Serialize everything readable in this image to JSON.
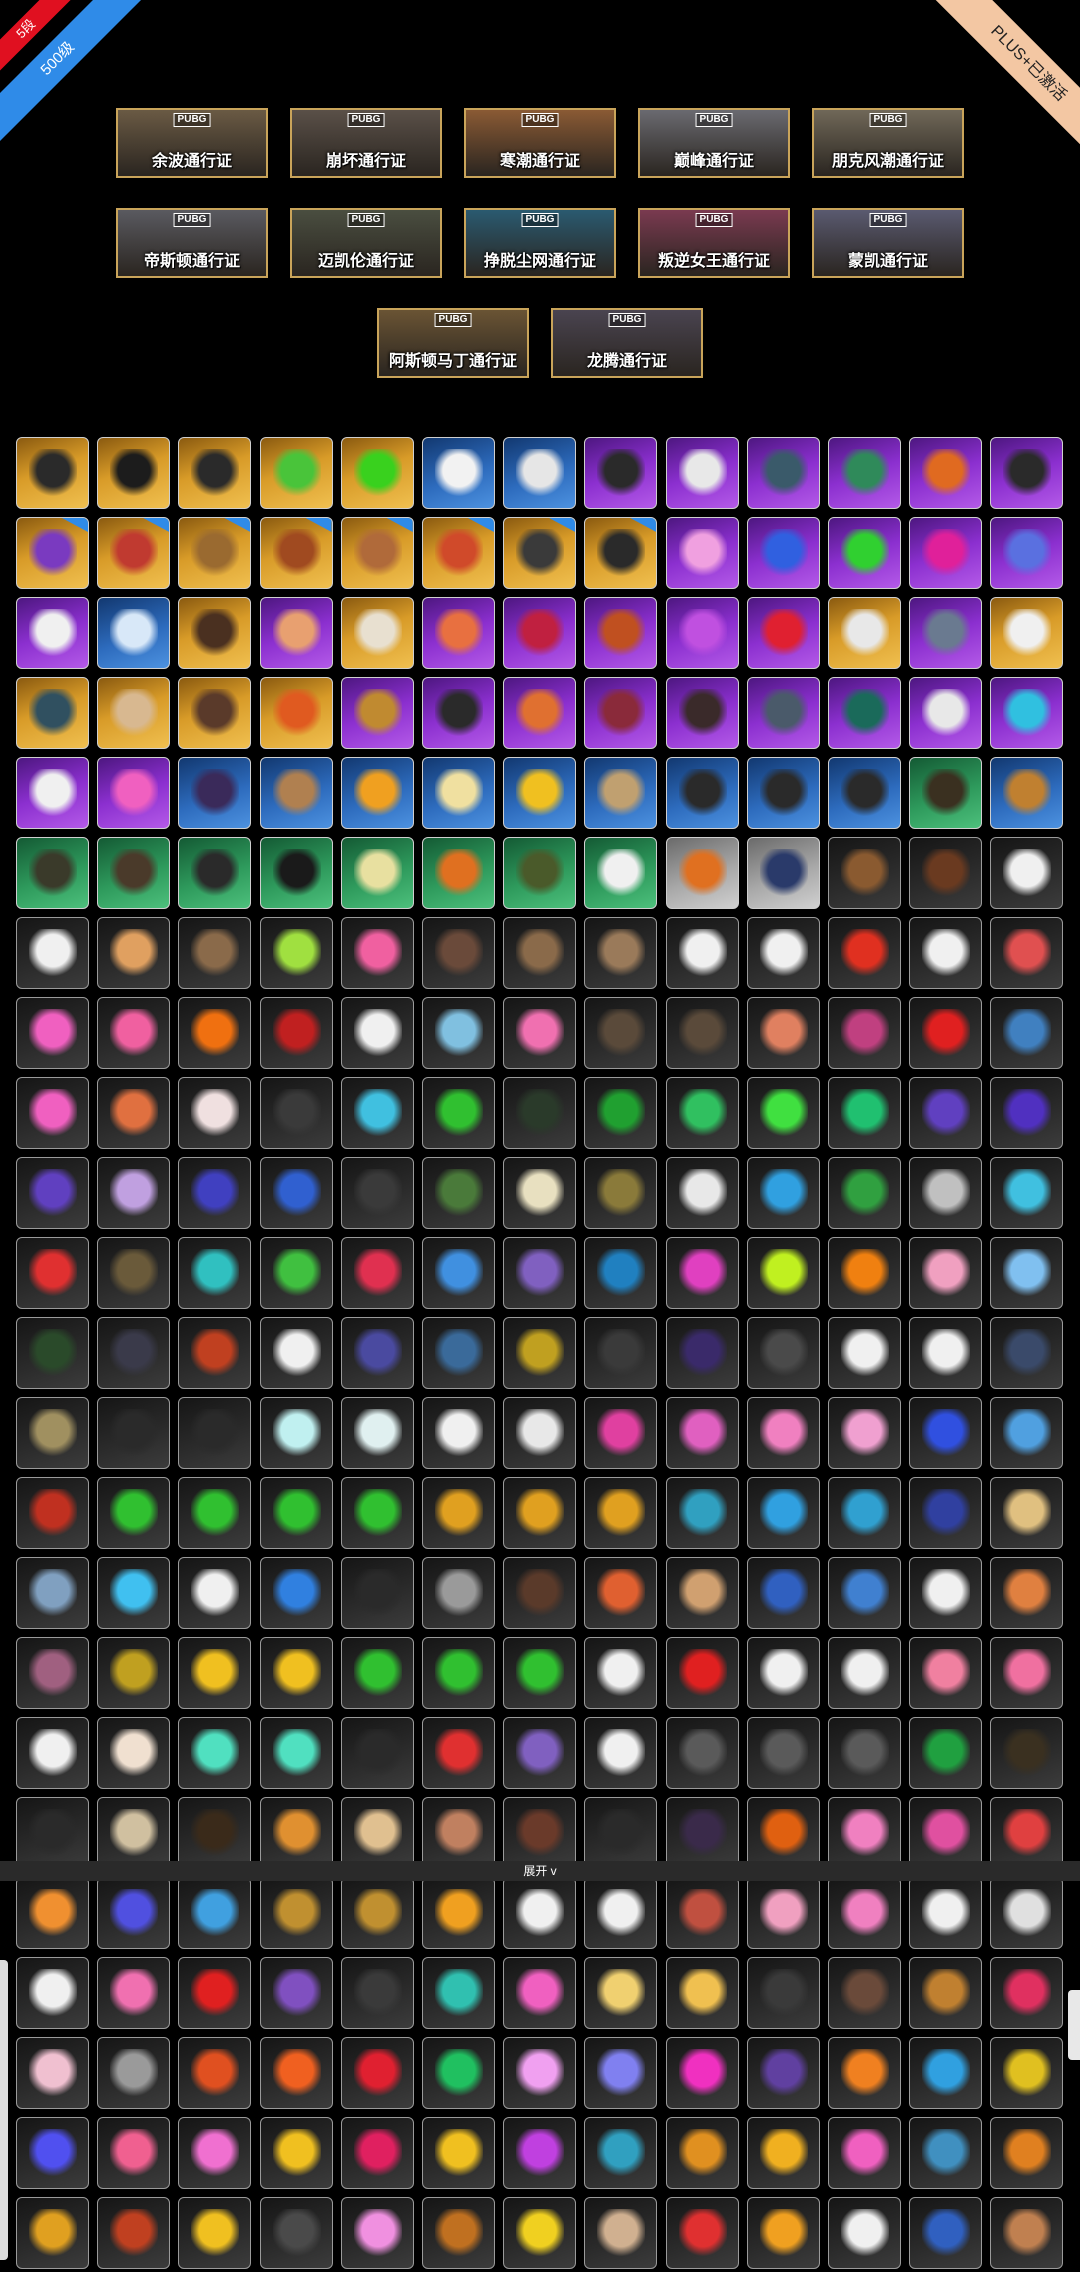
{
  "badges": {
    "rank": "5段",
    "level": "500级",
    "plus": "PLUS+已激活"
  },
  "passes": {
    "row1": [
      {
        "name": "余波通行证",
        "logo": "PUBG",
        "tone": "#6a5a44"
      },
      {
        "name": "崩坏通行证",
        "logo": "PUBG",
        "tone": "#5a5048"
      },
      {
        "name": "寒潮通行证",
        "logo": "PUBG",
        "tone": "#8a5a34"
      },
      {
        "name": "巅峰通行证",
        "logo": "PUBG",
        "tone": "#6a6a70"
      },
      {
        "name": "朋克风潮通行证",
        "logo": "PUBG",
        "tone": "#706858"
      }
    ],
    "row2": [
      {
        "name": "帝斯顿通行证",
        "logo": "PUBG",
        "tone": "#5a5a60"
      },
      {
        "name": "迈凯伦通行证",
        "logo": "PUBG",
        "tone": "#4a4e40"
      },
      {
        "name": "挣脱尘网通行证",
        "logo": "PUBG",
        "tone": "#2a5a70"
      },
      {
        "name": "叛逆女王通行证",
        "logo": "PUBG",
        "tone": "#7a3a50"
      },
      {
        "name": "蒙凯通行证",
        "logo": "PUBG",
        "tone": "#5a5a70"
      }
    ],
    "row3": [
      {
        "name": "阿斯顿马丁通行证",
        "logo": "PUBG",
        "tone": "#6a5434"
      },
      {
        "name": "龙腾通行证",
        "logo": "PUBG",
        "tone": "#4a4450"
      }
    ]
  },
  "expand_label": "展开 v",
  "items": {
    "rows": [
      [
        [
          "gold",
          "#2a2a2a"
        ],
        [
          "gold",
          "#1c1c1c"
        ],
        [
          "gold",
          "#2a2a2a"
        ],
        [
          "gold",
          "#49c43a"
        ],
        [
          "gold",
          "#39d11e"
        ],
        [
          "blue",
          "#f2f2f2"
        ],
        [
          "blue",
          "#e6e6e6"
        ],
        [
          "purple",
          "#2a2a2a"
        ],
        [
          "purple",
          "#e8e8e8"
        ],
        [
          "purple",
          "#3a5a6a"
        ],
        [
          "purple",
          "#2f8a5a"
        ],
        [
          "purple",
          "#e06a20"
        ],
        [
          "purple",
          "#2a2a2a"
        ]
      ],
      [
        [
          "gold",
          "#7a3ac0",
          1
        ],
        [
          "gold",
          "#c03a30",
          1
        ],
        [
          "gold",
          "#9a6a30",
          1
        ],
        [
          "gold",
          "#a04a20",
          1
        ],
        [
          "gold",
          "#b06a3a",
          1
        ],
        [
          "gold",
          "#d04a2a",
          1
        ],
        [
          "gold",
          "#3a3a3a",
          1
        ],
        [
          "gold",
          "#2a2a2a",
          1
        ],
        [
          "purple",
          "#f0a0e0"
        ],
        [
          "purple",
          "#3060e0"
        ],
        [
          "purple",
          "#30d030"
        ],
        [
          "purple",
          "#e0209a"
        ],
        [
          "purple",
          "#5a70e0"
        ]
      ],
      [
        [
          "purple",
          "#f0f0f0"
        ],
        [
          "blue",
          "#d8e8f8"
        ],
        [
          "gold",
          "#4a3020"
        ],
        [
          "purple",
          "#e8a070"
        ],
        [
          "gold",
          "#e8e0d0"
        ],
        [
          "purple",
          "#e87040"
        ],
        [
          "purple",
          "#c02040"
        ],
        [
          "purple",
          "#c05020"
        ],
        [
          "purple",
          "#c050e0"
        ],
        [
          "purple",
          "#e02030"
        ],
        [
          "gold",
          "#e8e8e8"
        ],
        [
          "purple",
          "#6a7a90"
        ],
        [
          "gold",
          "#f0f0f0"
        ]
      ],
      [
        [
          "gold",
          "#305060"
        ],
        [
          "gold",
          "#d8b890"
        ],
        [
          "gold",
          "#5a3a2a"
        ],
        [
          "gold",
          "#e05a20"
        ],
        [
          "purple",
          "#c08a30"
        ],
        [
          "purple",
          "#2a2a2a"
        ],
        [
          "purple",
          "#e07030"
        ],
        [
          "purple",
          "#8a2a3a"
        ],
        [
          "purple",
          "#3a2a2a"
        ],
        [
          "purple",
          "#4a5a6a"
        ],
        [
          "purple",
          "#1a6a5a"
        ],
        [
          "purple",
          "#e8e8e8"
        ],
        [
          "purple",
          "#30c0e0"
        ]
      ],
      [
        [
          "purple",
          "#f0f0f0"
        ],
        [
          "purple",
          "#f060c0"
        ],
        [
          "blue",
          "#3a2a5a"
        ],
        [
          "blue",
          "#b08050"
        ],
        [
          "blue",
          "#f0a020"
        ],
        [
          "blue",
          "#f0e0a0"
        ],
        [
          "blue",
          "#f0c020"
        ],
        [
          "blue",
          "#c0a070"
        ],
        [
          "blue",
          "#2a2a2a"
        ],
        [
          "blue",
          "#2a2a2a"
        ],
        [
          "blue",
          "#2a2a2a"
        ],
        [
          "green",
          "#3a3020"
        ],
        [
          "blue",
          "#c08030"
        ]
      ],
      [
        [
          "green",
          "#3a3a2a"
        ],
        [
          "green",
          "#4a3a2a"
        ],
        [
          "green",
          "#2a2a2a"
        ],
        [
          "green",
          "#1a1a1a"
        ],
        [
          "green",
          "#e8e0a0"
        ],
        [
          "green",
          "#e07020"
        ],
        [
          "green",
          "#4a5a2a"
        ],
        [
          "green",
          "#f0f0f0"
        ],
        [
          "gray",
          "#e07020"
        ],
        [
          "gray",
          "#2a3a6a"
        ],
        [
          "dark",
          "#8a5a30"
        ],
        [
          "dark",
          "#6a3a20"
        ],
        [
          "dark",
          "#f0f0f0"
        ]
      ],
      [
        [
          "dark",
          "#f0f0f0"
        ],
        [
          "dark",
          "#e0a060"
        ],
        [
          "dark",
          "#8a6a4a"
        ],
        [
          "dark",
          "#a0e040"
        ],
        [
          "dark",
          "#f060a0"
        ],
        [
          "dark",
          "#6a4a3a"
        ],
        [
          "dark",
          "#8a6a4a"
        ],
        [
          "dark",
          "#9a7a5a"
        ],
        [
          "dark",
          "#f0f0f0"
        ],
        [
          "dark",
          "#f0f0f0"
        ],
        [
          "dark",
          "#e03020"
        ],
        [
          "dark",
          "#f0f0f0"
        ],
        [
          "dark",
          "#e05050"
        ]
      ],
      [
        [
          "dark",
          "#f060c0"
        ],
        [
          "dark",
          "#f060a0"
        ],
        [
          "dark",
          "#f07010"
        ],
        [
          "dark",
          "#c02020"
        ],
        [
          "dark",
          "#f0f0f0"
        ],
        [
          "dark",
          "#80c0e0"
        ],
        [
          "dark",
          "#f070b0"
        ],
        [
          "dark",
          "#5a4a3a"
        ],
        [
          "dark",
          "#5a4a3a"
        ],
        [
          "dark",
          "#e08060"
        ],
        [
          "dark",
          "#c04080"
        ],
        [
          "dark",
          "#e02020"
        ],
        [
          "dark",
          "#4080c0"
        ]
      ],
      [
        [
          "dark",
          "#f060c0"
        ],
        [
          "dark",
          "#e07040"
        ],
        [
          "dark",
          "#f0e0e0"
        ],
        [
          "dark",
          "#3a3a3a"
        ],
        [
          "dark",
          "#40c0e0"
        ],
        [
          "dark",
          "#30c030"
        ],
        [
          "dark",
          "#2a3a2a"
        ],
        [
          "dark",
          "#20a030"
        ],
        [
          "dark",
          "#30c060"
        ],
        [
          "dark",
          "#40e040"
        ],
        [
          "dark",
          "#20c070"
        ],
        [
          "dark",
          "#6040c0"
        ],
        [
          "dark",
          "#5030c0"
        ]
      ],
      [
        [
          "dark",
          "#6040c0"
        ],
        [
          "dark",
          "#c0a0e0"
        ],
        [
          "dark",
          "#4040c0"
        ],
        [
          "dark",
          "#3060d0"
        ],
        [
          "dark",
          "#3a3a3a"
        ],
        [
          "dark",
          "#4a7a3a"
        ],
        [
          "dark",
          "#e8e0c0"
        ],
        [
          "dark",
          "#8a7a3a"
        ],
        [
          "dark",
          "#e8e8e8"
        ],
        [
          "dark",
          "#30a0e0"
        ],
        [
          "dark",
          "#30a040"
        ],
        [
          "dark",
          "#c0c0c0"
        ],
        [
          "dark",
          "#40c0e0"
        ]
      ],
      [
        [
          "dark",
          "#e03030"
        ],
        [
          "dark",
          "#6a5a3a"
        ],
        [
          "dark",
          "#30c0c0"
        ],
        [
          "dark",
          "#40c040"
        ],
        [
          "dark",
          "#e03050"
        ],
        [
          "dark",
          "#4090e0"
        ],
        [
          "dark",
          "#8060c0"
        ],
        [
          "dark",
          "#2080c0"
        ],
        [
          "dark",
          "#e040c0"
        ],
        [
          "dark",
          "#c0f020"
        ],
        [
          "dark",
          "#f08010"
        ],
        [
          "dark",
          "#f0a0c0"
        ],
        [
          "dark",
          "#80c0f0"
        ]
      ],
      [
        [
          "dark",
          "#2a4a2a"
        ],
        [
          "dark",
          "#3a3a4a"
        ],
        [
          "dark",
          "#c04020"
        ],
        [
          "dark",
          "#f0f0f0"
        ],
        [
          "dark",
          "#4a4aa0"
        ],
        [
          "dark",
          "#3a6a9a"
        ],
        [
          "dark",
          "#c0a020"
        ],
        [
          "dark",
          "#3a3a3a"
        ],
        [
          "dark",
          "#3a2a6a"
        ],
        [
          "dark",
          "#4a4a4a"
        ],
        [
          "dark",
          "#f0f0f0"
        ],
        [
          "dark",
          "#f0f0f0"
        ],
        [
          "dark",
          "#3a4a6a"
        ]
      ],
      [
        [
          "dark",
          "#a09060"
        ],
        [
          "dark",
          "#2a2a2a"
        ],
        [
          "dark",
          "#2a2a2a"
        ],
        [
          "dark",
          "#c0f0f0"
        ],
        [
          "dark",
          "#e0f0f0"
        ],
        [
          "dark",
          "#f0f0f0"
        ],
        [
          "dark",
          "#e8e8e8"
        ],
        [
          "dark",
          "#e040a0"
        ],
        [
          "dark",
          "#e060c0"
        ],
        [
          "dark",
          "#f080c0"
        ],
        [
          "dark",
          "#f0a0d0"
        ],
        [
          "dark",
          "#3050e0"
        ],
        [
          "dark",
          "#50a0e0"
        ]
      ],
      [
        [
          "dark",
          "#c03020"
        ],
        [
          "dark",
          "#30c030"
        ],
        [
          "dark",
          "#30c030"
        ],
        [
          "dark",
          "#30c030"
        ],
        [
          "dark",
          "#30c030"
        ],
        [
          "dark",
          "#e0a020"
        ],
        [
          "dark",
          "#e0a020"
        ],
        [
          "dark",
          "#e0a020"
        ],
        [
          "dark",
          "#30a0c0"
        ],
        [
          "dark",
          "#30a0e0"
        ],
        [
          "dark",
          "#30a0d0"
        ],
        [
          "dark",
          "#3040a0"
        ],
        [
          "dark",
          "#e0c080"
        ]
      ],
      [
        [
          "dark",
          "#80a0c0"
        ],
        [
          "dark",
          "#40c0f0"
        ],
        [
          "dark",
          "#f0f0f0"
        ],
        [
          "dark",
          "#3080e0"
        ],
        [
          "dark",
          "#2a2a2a"
        ],
        [
          "dark",
          "#9a9a9a"
        ],
        [
          "dark",
          "#5a3a2a"
        ],
        [
          "dark",
          "#e06030"
        ],
        [
          "dark",
          "#d0a070"
        ],
        [
          "dark",
          "#3060c0"
        ],
        [
          "dark",
          "#4080d0"
        ],
        [
          "dark",
          "#f0f0f0"
        ],
        [
          "dark",
          "#e08040"
        ]
      ],
      [
        [
          "dark",
          "#a06080"
        ],
        [
          "dark",
          "#c0a020"
        ],
        [
          "dark",
          "#f0c020"
        ],
        [
          "dark",
          "#f0c020"
        ],
        [
          "dark",
          "#30c030"
        ],
        [
          "dark",
          "#30c030"
        ],
        [
          "dark",
          "#30c030"
        ],
        [
          "dark",
          "#f0f0f0"
        ],
        [
          "dark",
          "#e02020"
        ],
        [
          "dark",
          "#f0f0f0"
        ],
        [
          "dark",
          "#f0f0f0"
        ],
        [
          "dark",
          "#f080a0"
        ],
        [
          "dark",
          "#f070a0"
        ]
      ],
      [
        [
          "dark",
          "#f0f0f0"
        ],
        [
          "dark",
          "#f0e0d0"
        ],
        [
          "dark",
          "#50e0c0"
        ],
        [
          "dark",
          "#50e0c0"
        ],
        [
          "dark",
          "#2a2a2a"
        ],
        [
          "dark",
          "#e03030"
        ],
        [
          "dark",
          "#8060c0"
        ],
        [
          "dark",
          "#f0f0f0"
        ],
        [
          "dark",
          "#5a5a5a"
        ],
        [
          "dark",
          "#5a5a5a"
        ],
        [
          "dark",
          "#5a5a5a"
        ],
        [
          "dark",
          "#20a040"
        ],
        [
          "dark",
          "#3a3020"
        ]
      ],
      [
        [
          "dark",
          "#2a2a2a"
        ],
        [
          "dark",
          "#d0c0a0"
        ],
        [
          "dark",
          "#3a2a1a"
        ],
        [
          "dark",
          "#e09030"
        ],
        [
          "dark",
          "#e0c090"
        ],
        [
          "dark",
          "#c08060"
        ],
        [
          "dark",
          "#6a3a2a"
        ],
        [
          "dark",
          "#2a2a2a"
        ],
        [
          "dark",
          "#3a2a4a"
        ],
        [
          "dark",
          "#e06010"
        ],
        [
          "dark",
          "#f080c0"
        ],
        [
          "dark",
          "#e050a0"
        ],
        [
          "dark",
          "#e04040"
        ]
      ],
      [
        [
          "dark",
          "#f09030"
        ],
        [
          "dark",
          "#5050e0"
        ],
        [
          "dark",
          "#40a0e0"
        ],
        [
          "dark",
          "#c09030"
        ],
        [
          "dark",
          "#c09030"
        ],
        [
          "dark",
          "#f0a020"
        ],
        [
          "dark",
          "#f0f0f0"
        ],
        [
          "dark",
          "#f0f0f0"
        ],
        [
          "dark",
          "#c05040"
        ],
        [
          "dark",
          "#f0a0c0"
        ],
        [
          "dark",
          "#f080c0"
        ],
        [
          "dark",
          "#f0f0f0"
        ],
        [
          "dark",
          "#e0e0e0"
        ]
      ],
      [
        [
          "dark",
          "#f0f0f0"
        ],
        [
          "dark",
          "#f070b0"
        ],
        [
          "dark",
          "#e02020"
        ],
        [
          "dark",
          "#8050c0"
        ],
        [
          "dark",
          "#3a3a3a"
        ],
        [
          "dark",
          "#30c0b0"
        ],
        [
          "dark",
          "#f060c0"
        ],
        [
          "dark",
          "#f0d070"
        ],
        [
          "dark",
          "#f0c050"
        ],
        [
          "dark",
          "#3a3a3a"
        ],
        [
          "dark",
          "#6a4a3a"
        ],
        [
          "dark",
          "#c08030"
        ],
        [
          "dark",
          "#e03060"
        ]
      ],
      [
        [
          "dark",
          "#f0c0d0"
        ],
        [
          "dark",
          "#9a9a9a"
        ],
        [
          "dark",
          "#e05020"
        ],
        [
          "dark",
          "#f06020"
        ],
        [
          "dark",
          "#e02030"
        ],
        [
          "dark",
          "#20c060"
        ],
        [
          "dark",
          "#f0a0f0"
        ],
        [
          "dark",
          "#8080f0"
        ],
        [
          "dark",
          "#f030c0"
        ],
        [
          "dark",
          "#6040a0"
        ],
        [
          "dark",
          "#f08020"
        ],
        [
          "dark",
          "#30a0e0"
        ],
        [
          "dark",
          "#e0c020"
        ]
      ],
      [
        [
          "dark",
          "#5050f0"
        ],
        [
          "dark",
          "#f06090"
        ],
        [
          "dark",
          "#f070d0"
        ],
        [
          "dark",
          "#f0c020"
        ],
        [
          "dark",
          "#e02060"
        ],
        [
          "dark",
          "#f0c020"
        ],
        [
          "dark",
          "#c040e0"
        ],
        [
          "dark",
          "#30a0c0"
        ],
        [
          "dark",
          "#e09020"
        ],
        [
          "dark",
          "#f0b020"
        ],
        [
          "dark",
          "#f060c0"
        ],
        [
          "dark",
          "#4090c0"
        ],
        [
          "dark",
          "#e08020"
        ]
      ],
      [
        [
          "dark",
          "#e0a020"
        ],
        [
          "dark",
          "#c04020"
        ],
        [
          "dark",
          "#f0c020"
        ],
        [
          "dark",
          "#4a4a4a"
        ],
        [
          "dark",
          "#f090e0"
        ],
        [
          "dark",
          "#c07020"
        ],
        [
          "dark",
          "#f0d020"
        ],
        [
          "dark",
          "#d0b090"
        ],
        [
          "dark",
          "#e03030"
        ],
        [
          "dark",
          "#f0a020"
        ],
        [
          "dark",
          "#f0f0f0"
        ],
        [
          "dark",
          "#3060c0"
        ],
        [
          "dark",
          "#c08050"
        ]
      ]
    ]
  }
}
